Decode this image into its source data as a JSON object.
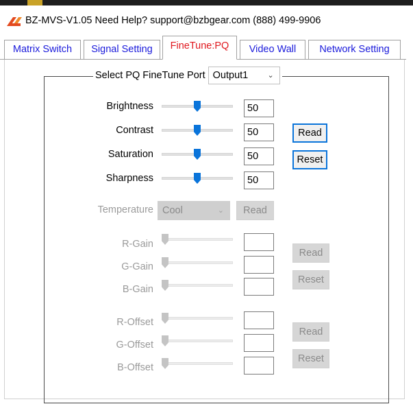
{
  "window": {
    "title": "BZ-MVS-V1.05  Need Help? support@bzbgear.com (888) 499-9906",
    "icon": "bzbgear-logo-icon"
  },
  "tabs": [
    {
      "label": "Matrix Switch",
      "active": false
    },
    {
      "label": "Signal Setting",
      "active": false
    },
    {
      "label": "FineTune:PQ",
      "active": true
    },
    {
      "label": "Video Wall",
      "active": false
    },
    {
      "label": "Network Setting",
      "active": false
    }
  ],
  "pq_group": {
    "port_label": "Select PQ FineTune Port",
    "port_value": "Output1",
    "controls": [
      {
        "label": "Brightness",
        "value": "50",
        "level": 0.5
      },
      {
        "label": "Contrast",
        "value": "50",
        "level": 0.5
      },
      {
        "label": "Saturation",
        "value": "50",
        "level": 0.5
      },
      {
        "label": "Sharpness",
        "value": "50",
        "level": 0.5
      }
    ],
    "read_label": "Read",
    "reset_label": "Reset"
  },
  "temperature": {
    "label": "Temperature",
    "value": "Cool",
    "read_label": "Read",
    "enabled": false
  },
  "gain": {
    "rows": [
      {
        "label": "R-Gain",
        "value": "",
        "level": 0.0
      },
      {
        "label": "G-Gain",
        "value": "",
        "level": 0.0
      },
      {
        "label": "B-Gain",
        "value": "",
        "level": 0.0
      }
    ],
    "read_label": "Read",
    "reset_label": "Reset",
    "enabled": false
  },
  "offset": {
    "rows": [
      {
        "label": "R-Offset",
        "value": "",
        "level": 0.0
      },
      {
        "label": "G-Offset",
        "value": "",
        "level": 0.0
      },
      {
        "label": "B-Offset",
        "value": "",
        "level": 0.0
      }
    ],
    "read_label": "Read",
    "reset_label": "Reset",
    "enabled": false
  },
  "colors": {
    "tab_text": "#1a1adb",
    "tab_active_text": "#e0191f",
    "slider_thumb": "#0a74da",
    "button_focus_border": "#0a74da",
    "disabled_text": "#9a9a9a"
  }
}
